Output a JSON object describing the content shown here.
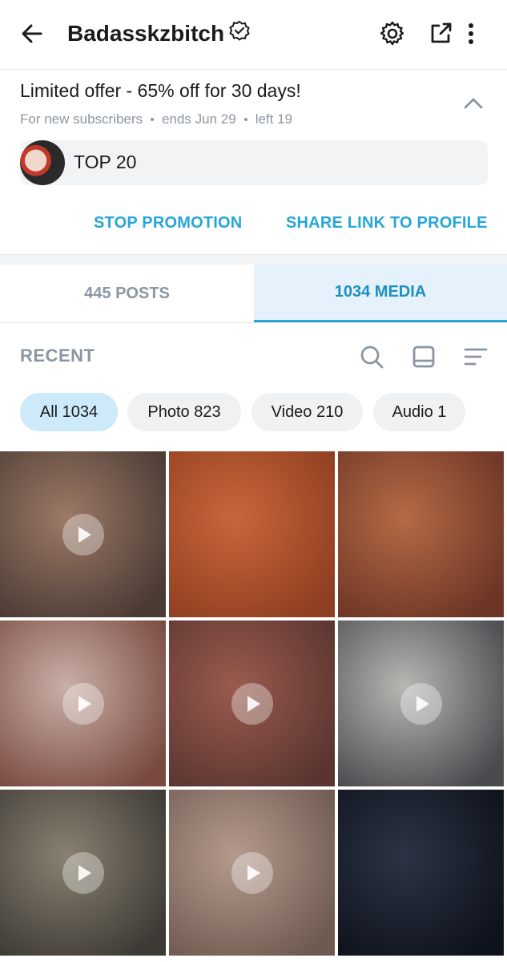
{
  "header": {
    "username": "Badasskzbitch",
    "verified_icon": "verified-badge-icon",
    "back_icon": "arrow-left-icon",
    "settings_icon": "gear-icon",
    "share_icon": "share-icon",
    "more_icon": "more-vertical-icon"
  },
  "promo": {
    "title": "Limited offer - 65% off for 30 days!",
    "subtitle_parts": [
      "For new subscribers",
      "ends Jun 29",
      "left 19"
    ],
    "list_label": "TOP 20",
    "stop_label": "STOP PROMOTION",
    "share_label": "SHARE LINK TO PROFILE",
    "collapse_icon": "chevron-up-icon"
  },
  "tabs": [
    {
      "label": "445 POSTS",
      "active": false
    },
    {
      "label": "1034 MEDIA",
      "active": true
    }
  ],
  "toolbar": {
    "section_label": "RECENT",
    "icons": [
      "search-icon",
      "grid-view-icon",
      "sort-icon"
    ]
  },
  "filters": [
    {
      "label": "All 1034",
      "active": true
    },
    {
      "label": "Photo 823",
      "active": false
    },
    {
      "label": "Video 210",
      "active": false
    },
    {
      "label": "Audio 1",
      "active": false
    }
  ],
  "media": [
    {
      "type": "video",
      "colors": [
        "#9c7a66",
        "#4a3a34"
      ]
    },
    {
      "type": "photo",
      "colors": [
        "#c8663a",
        "#8f3f22"
      ]
    },
    {
      "type": "photo",
      "colors": [
        "#b66a46",
        "#6c3525"
      ]
    },
    {
      "type": "video",
      "colors": [
        "#c9b0a8",
        "#7a4a40"
      ]
    },
    {
      "type": "video",
      "colors": [
        "#9a5b4e",
        "#5a3530"
      ]
    },
    {
      "type": "video",
      "colors": [
        "#b9b7b2",
        "#4a4a4f"
      ]
    },
    {
      "type": "video",
      "colors": [
        "#8a8170",
        "#3d3a35"
      ]
    },
    {
      "type": "video",
      "colors": [
        "#b59b8d",
        "#6f5a51"
      ]
    },
    {
      "type": "photo",
      "colors": [
        "#2d3344",
        "#0e121c"
      ]
    }
  ]
}
